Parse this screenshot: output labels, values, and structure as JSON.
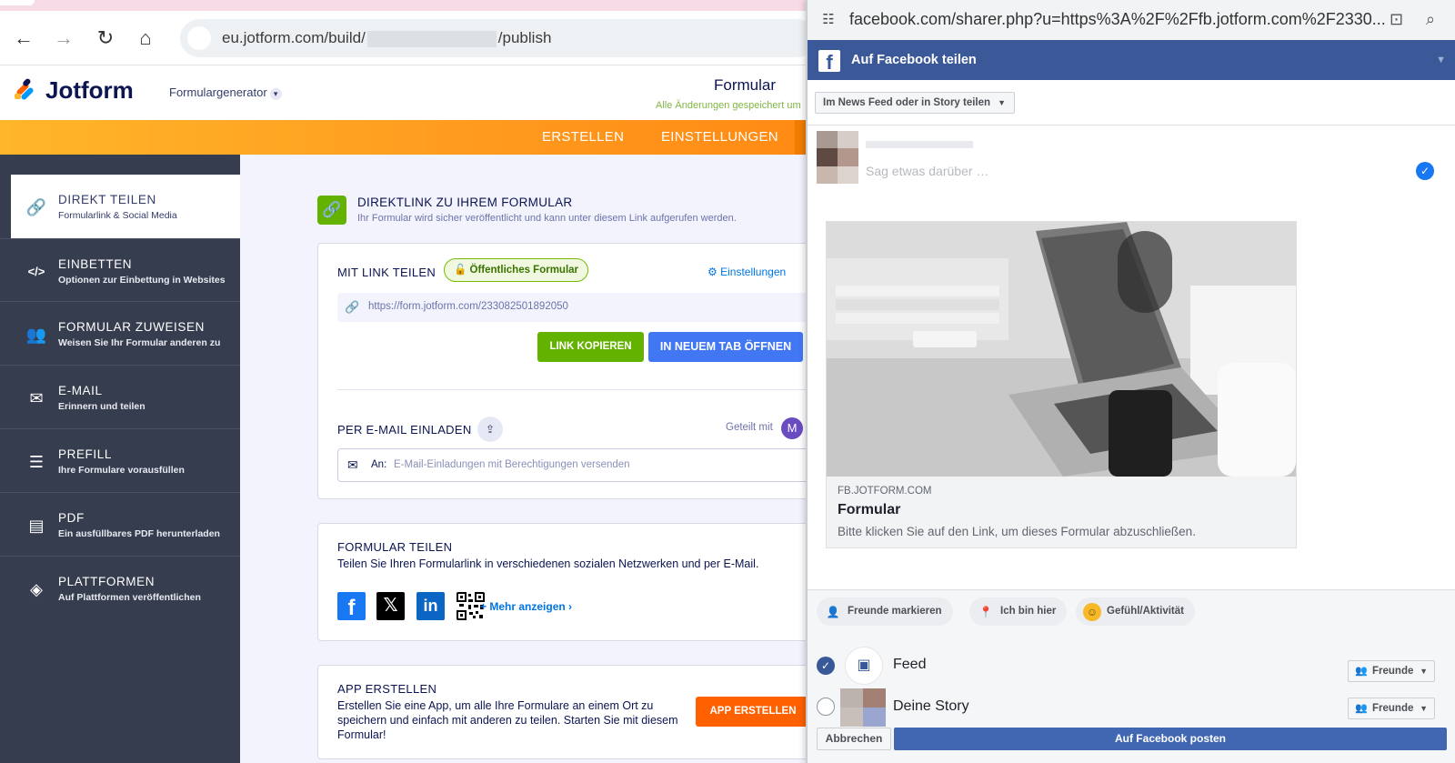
{
  "browser": {
    "url_prefix": "eu.jotform.com/build/",
    "url_suffix": "/publish"
  },
  "header": {
    "logo_text": "Jotform",
    "form_generator": "Formulargenerator",
    "form_title": "Formular",
    "saved_status": "Alle Änderungen gespeichert um"
  },
  "nav": {
    "tabs": [
      {
        "label": "ERSTELLEN"
      },
      {
        "label": "EINSTELLUNGEN"
      }
    ]
  },
  "sidebar": {
    "items": [
      {
        "title": "DIREKT TEILEN",
        "subtitle": "Formularlink & Social Media",
        "icon": "link-icon"
      },
      {
        "title": "EINBETTEN",
        "subtitle": "Optionen zur Einbettung in Websites",
        "icon": "code-icon"
      },
      {
        "title": "FORMULAR ZUWEISEN",
        "subtitle": "Weisen Sie Ihr Formular anderen zu",
        "icon": "users-icon"
      },
      {
        "title": "E-MAIL",
        "subtitle": "Erinnern und teilen",
        "icon": "envelope-icon"
      },
      {
        "title": "PREFILL",
        "subtitle": "Ihre Formulare vorausfüllen",
        "icon": "prefill-icon"
      },
      {
        "title": "PDF",
        "subtitle": "Ein ausfüllbares PDF herunterladen",
        "icon": "pdf-icon"
      },
      {
        "title": "PLATTFORMEN",
        "subtitle": "Auf Plattformen veröffentlichen",
        "icon": "layers-icon"
      }
    ]
  },
  "direct_link": {
    "title": "DIREKTLINK ZU IHREM FORMULAR",
    "subtitle": "Ihr Formular wird sicher veröffentlicht und kann unter diesem Link aufgerufen werden."
  },
  "share_link": {
    "label": "MIT LINK TEILEN",
    "badge": "Öffentliches Formular",
    "settings": "Einstellungen",
    "url": "https://form.jotform.com/233082501892050",
    "copy_button": "LINK KOPIEREN",
    "open_button": "IN NEUEM TAB ÖFFNEN"
  },
  "email_invite": {
    "label": "PER E-MAIL EINLADEN",
    "shared_with": "Geteilt mit",
    "avatar_letter": "M",
    "to_label": "An:",
    "placeholder": "E-Mail-Einladungen mit Berechtigungen versenden"
  },
  "share_form": {
    "label": "FORMULAR TEILEN",
    "description": "Teilen Sie Ihren Formularlink in verschiedenen sozialen Netzwerken und per E-Mail.",
    "more": "Mehr anzeigen"
  },
  "app": {
    "label": "APP ERSTELLEN",
    "description_line1": "Erstellen Sie eine App, um alle Ihre Formulare an einem Ort zu",
    "description_line2": "speichern und einfach mit anderen zu teilen. Starten Sie mit diesem",
    "description_line3": "Formular!",
    "button": "APP ERSTELLEN"
  },
  "facebook": {
    "url": "facebook.com/sharer.php?u=https%3A%2F%2Ffb.jotform.com%2F2330...",
    "bar_title": "Auf Facebook teilen",
    "share_target": "Im News Feed oder in Story teilen",
    "say_placeholder": "Sag etwas darüber …",
    "preview": {
      "domain": "FB.JOTFORM.COM",
      "title": "Formular",
      "description": "Bitte klicken Sie auf den Link, um dieses Formular abzuschließen."
    },
    "actions": [
      {
        "label": "Freunde markieren"
      },
      {
        "label": "Ich bin hier"
      },
      {
        "label": "Gefühl/Aktivität"
      }
    ],
    "destinations": [
      {
        "label": "Feed",
        "audience": "Freunde",
        "selected": true
      },
      {
        "label": "Deine Story",
        "audience": "Freunde",
        "selected": false
      }
    ],
    "cancel": "Abbrechen",
    "post": "Auf Facebook posten"
  },
  "colors": {
    "jotform_orange": "#ff9a1f",
    "sidebar_bg": "#363d4f",
    "green": "#64b200",
    "blue": "#4277f4",
    "facebook_blue": "#3b5998"
  }
}
